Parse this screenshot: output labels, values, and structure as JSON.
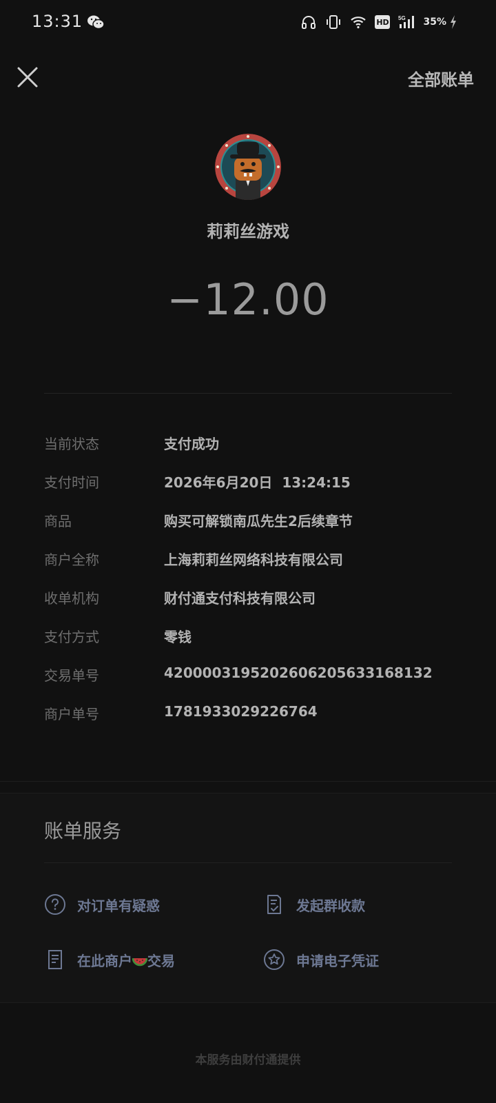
{
  "status_bar": {
    "time": "13:31",
    "network": "5G",
    "hd": "HD",
    "battery": "35%"
  },
  "header": {
    "all_bills": "全部账单"
  },
  "merchant": {
    "name": "莉莉丝游戏"
  },
  "amount": "−12.00",
  "details": [
    {
      "label": "当前状态",
      "value": "支付成功"
    },
    {
      "label": "支付时间",
      "value": "2026年6月20日  13:24:15"
    },
    {
      "label": "商品",
      "value": "购买可解锁南瓜先生2后续章节"
    },
    {
      "label": "商户全称",
      "value": "上海莉莉丝网络科技有限公司"
    },
    {
      "label": "收单机构",
      "value": "财付通支付科技有限公司"
    },
    {
      "label": "支付方式",
      "value": "零钱"
    },
    {
      "label": "交易单号",
      "value": "4200003195202606205633168132"
    },
    {
      "label": "商户单号",
      "value": "1781933029226764"
    }
  ],
  "services": {
    "title": "账单服务",
    "items": [
      {
        "label": "对订单有疑惑",
        "icon": "question-circle-icon"
      },
      {
        "label": "发起群收款",
        "icon": "document-check-icon"
      },
      {
        "label_before": "在此商户",
        "label_after": "交易",
        "icon": "receipt-icon"
      },
      {
        "label": "申请电子凭证",
        "icon": "star-circle-icon"
      }
    ]
  },
  "footer": {
    "text": "本服务由财付通提供"
  },
  "colors": {
    "background": "#111111",
    "service_link": "#6d7893",
    "muted_label": "#6e6e6e"
  }
}
